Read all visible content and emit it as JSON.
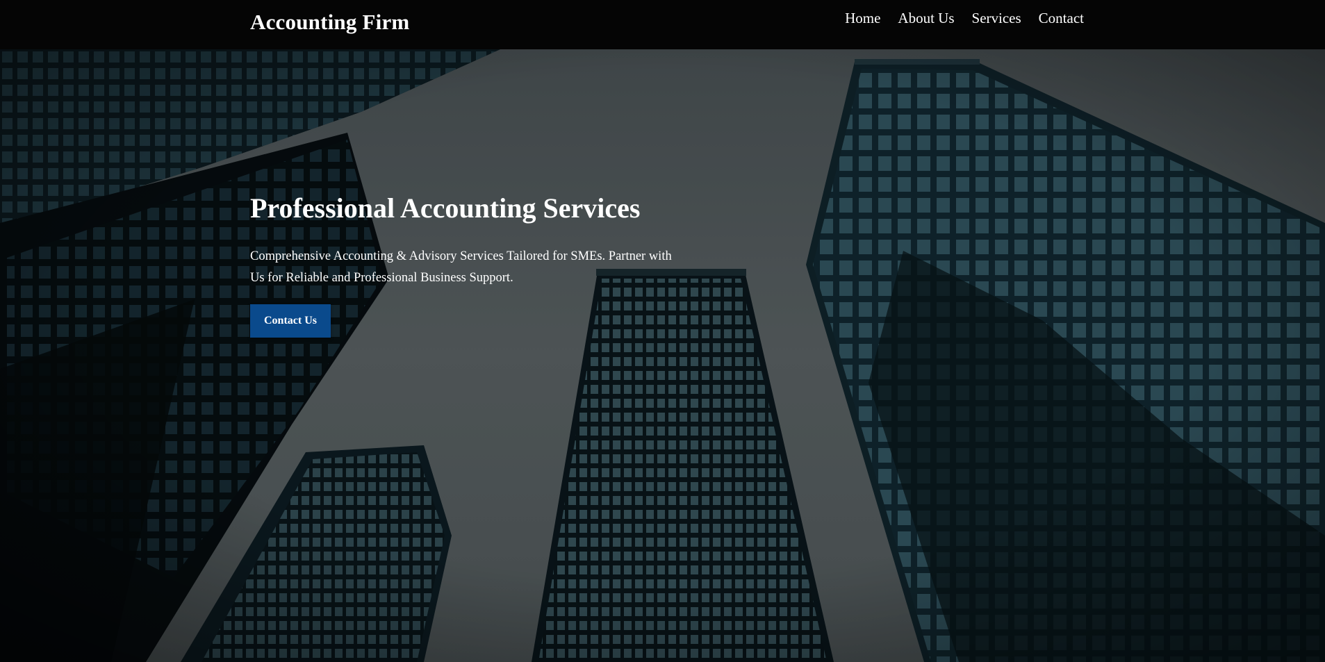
{
  "header": {
    "logo": "Accounting Firm",
    "nav": [
      "Home",
      "About Us",
      "Services",
      "Contact"
    ]
  },
  "hero": {
    "title": "Professional Accounting Services",
    "text": "Comprehensive Accounting & Advisory Services Tailored for SMEs. Partner with Us for Reliable and Professional Business Support.",
    "button_label": "Contact Us"
  },
  "colors": {
    "header_bg": "#050505",
    "button_bg": "#0a4a8c",
    "text": "#ffffff"
  }
}
